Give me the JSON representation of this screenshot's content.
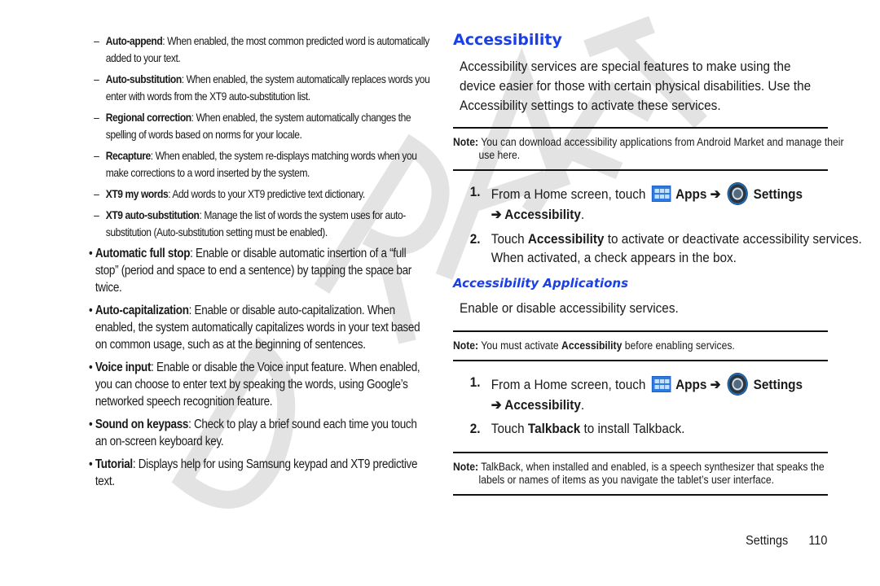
{
  "watermark": {
    "text": "DRAFT",
    "color": "#e3e3e3"
  },
  "left_column": {
    "sub_items": [
      {
        "term": "Auto-append",
        "text": ": When enabled, the most common predicted word is automatically added to your text."
      },
      {
        "term": "Auto-substitution",
        "text": ": When enabled, the system automatically replaces words you enter with words from the XT9 auto-substitution list."
      },
      {
        "term": "Regional correction",
        "text": ": When enabled, the system automatically changes the spelling of words based on norms for your locale."
      },
      {
        "term": "Recapture",
        "text": ": When enabled, the system re-displays matching words when you make corrections to a word inserted by the system."
      },
      {
        "term": "XT9 my words",
        "text": ": Add words to your XT9 predictive text dictionary."
      },
      {
        "term": "XT9 auto-substitution",
        "text": ": Manage the list of words the system uses for auto-substitution (Auto-substitution setting must be enabled)."
      }
    ],
    "bullets": [
      {
        "term": "Automatic full stop",
        "text": ": Enable or disable automatic insertion of a “full stop” (period and space to end a sentence) by tapping the space bar twice."
      },
      {
        "term": "Auto-capitalization",
        "text": ": Enable or disable auto-capitalization. When enabled, the system automatically capitalizes words in your text based on common usage, such as at the beginning of sentences."
      },
      {
        "term": "Voice input",
        "text": ": Enable or disable the Voice input feature. When enabled, you can choose to enter text by speaking the words, using Google’s networked speech recognition feature."
      },
      {
        "term": "Sound on keypass",
        "text": ": Check to play a brief sound each time you touch an on-screen keyboard key."
      },
      {
        "term": "Tutorial",
        "text": ": Displays help for using Samsung keypad and XT9 predictive text."
      }
    ],
    "dash": "–",
    "dot": "•"
  },
  "right_column": {
    "heading": "Accessibility",
    "intro": "Accessibility services are special features to make using the device easier for those with certain physical disabilities. Use the Accessibility settings to activate these services.",
    "note1": {
      "label": "Note:",
      "text": " You can download accessibility applications from Android Market and manage their use here."
    },
    "steps1": {
      "s1": {
        "num": "1.",
        "pre": "From a Home screen, touch",
        "apps": "Apps",
        "arrow": " ➔",
        "settings": "Settings",
        "accessibility": "➔ Accessibility",
        "end": "."
      },
      "s2": {
        "num": "2.",
        "pre": "Touch ",
        "bold": "Accessibility",
        "post": " to activate or deactivate accessibility services. When activated, a check appears in the box."
      }
    },
    "subheading": "Accessibility Applications",
    "para": "Enable or disable accessibility services.",
    "note2": {
      "label": "Note:",
      "pre": " You must activate ",
      "bold": "Accessibility",
      "post": " before enabling services."
    },
    "steps2": {
      "s1": {
        "num": "1.",
        "pre": "From a Home screen, touch",
        "apps": "Apps",
        "arrow": " ➔",
        "settings": "Settings",
        "accessibility": "➔ Accessibility",
        "end": "."
      },
      "s2": {
        "num": "2.",
        "pre": "Touch ",
        "bold": "Talkback",
        "post": " to install Talkback."
      }
    },
    "note3": {
      "label": "Note:",
      "text": " TalkBack, when installed and enabled, is a speech synthesizer that speaks the labels or names of items as you navigate the tablet’s user interface."
    }
  },
  "footer": {
    "section": "Settings",
    "page": "110"
  },
  "colors": {
    "heading_blue": "#1a3fe6",
    "apps_icon_blue": "#2c7be5"
  }
}
